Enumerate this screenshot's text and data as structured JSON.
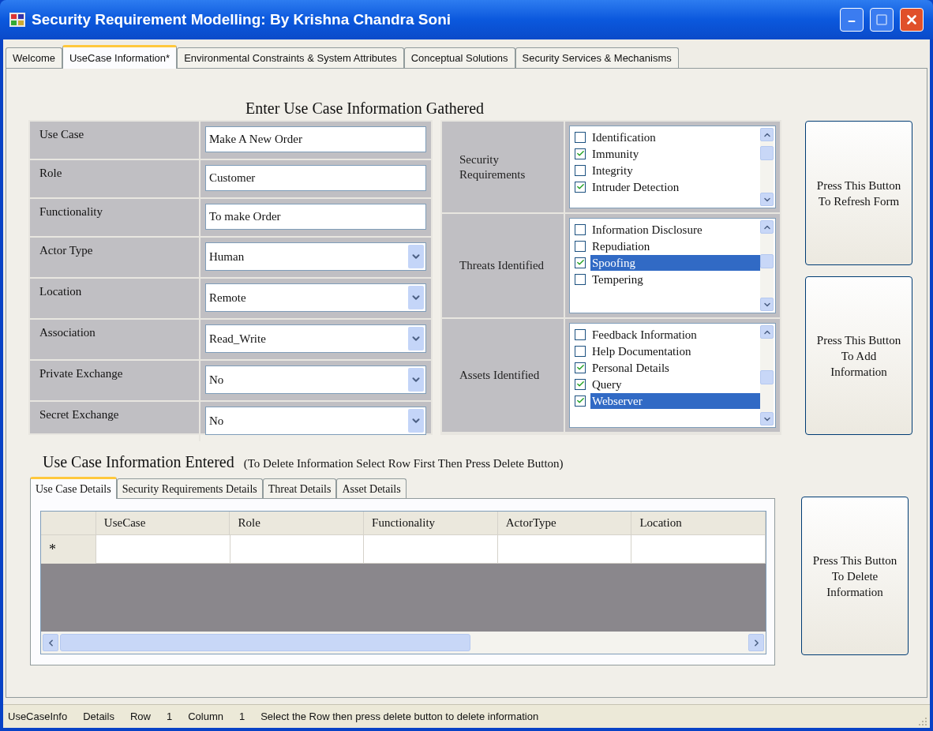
{
  "window": {
    "title": "Security Requirement Modelling: By Krishna Chandra Soni"
  },
  "tabs": [
    {
      "label": "Welcome",
      "selected": false
    },
    {
      "label": "UseCase Information*",
      "selected": true
    },
    {
      "label": "Environmental Constraints & System Attributes",
      "selected": false
    },
    {
      "label": "Conceptual Solutions",
      "selected": false
    },
    {
      "label": "Security Services & Mechanisms",
      "selected": false
    }
  ],
  "form": {
    "heading": "Enter Use Case Information Gathered",
    "fields": [
      {
        "label": "Use Case",
        "kind": "text",
        "value": "Make A New Order"
      },
      {
        "label": "Role",
        "kind": "text",
        "value": "Customer"
      },
      {
        "label": "Functionality",
        "kind": "text",
        "value": "To make Order"
      },
      {
        "label": "Actor Type",
        "kind": "dropdown",
        "value": "Human"
      },
      {
        "label": "Location",
        "kind": "dropdown",
        "value": "Remote"
      },
      {
        "label": "Association",
        "kind": "dropdown",
        "value": "Read_Write"
      },
      {
        "label": "Private Exchange",
        "kind": "dropdown",
        "value": "No"
      },
      {
        "label": "Secret Exchange",
        "kind": "dropdown",
        "value": "No"
      }
    ]
  },
  "checklists": [
    {
      "label": "Security Requirements",
      "items": [
        {
          "text": "Identification",
          "checked": false,
          "selected": false
        },
        {
          "text": "Immunity",
          "checked": true,
          "selected": false
        },
        {
          "text": "Integrity",
          "checked": false,
          "selected": false
        },
        {
          "text": "Intruder Detection",
          "checked": true,
          "selected": false
        }
      ]
    },
    {
      "label": "Threats Identified",
      "items": [
        {
          "text": "Information Disclosure",
          "checked": false,
          "selected": false
        },
        {
          "text": "Repudiation",
          "checked": false,
          "selected": false
        },
        {
          "text": "Spoofing",
          "checked": true,
          "selected": true
        },
        {
          "text": "Tempering",
          "checked": false,
          "selected": false
        }
      ]
    },
    {
      "label": "Assets Identified",
      "items": [
        {
          "text": "Feedback Information",
          "checked": false,
          "selected": false
        },
        {
          "text": "Help Documentation",
          "checked": false,
          "selected": false
        },
        {
          "text": "Personal Details",
          "checked": true,
          "selected": false
        },
        {
          "text": "Query",
          "checked": true,
          "selected": false
        },
        {
          "text": "Webserver",
          "checked": true,
          "selected": true
        }
      ]
    }
  ],
  "buttons": {
    "refresh": "Press This Button To Refresh Form",
    "add": "Press This Button To Add Information",
    "delete": "Press This Button To Delete Information"
  },
  "entered": {
    "heading": "Use Case Information Entered",
    "hint": "(To Delete Information Select Row First Then Press Delete Button)",
    "tabs": [
      {
        "label": "Use Case Details",
        "selected": true
      },
      {
        "label": "Security Requirements Details",
        "selected": false
      },
      {
        "label": "Threat Details",
        "selected": false
      },
      {
        "label": "Asset Details",
        "selected": false
      }
    ],
    "table": {
      "columns": [
        "UseCase",
        "Role",
        "Functionality",
        "ActorType",
        "Location"
      ],
      "new_row_marker": "*"
    }
  },
  "status_bar": [
    "UseCaseInfo",
    "Details",
    "Row",
    "1",
    "Column",
    "1",
    "Select the Row then press delete button to delete information"
  ]
}
